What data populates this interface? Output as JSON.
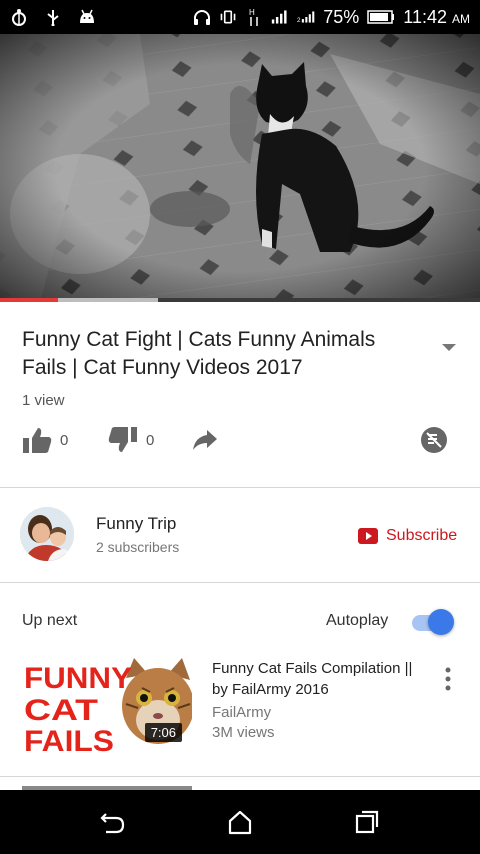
{
  "status_bar": {
    "battery_percent": "75%",
    "time": "11:42",
    "time_suffix": "AM"
  },
  "player": {
    "progress": 0.12,
    "buffered": 0.33
  },
  "video": {
    "title": "Funny Cat Fight | Cats Funny Animals Fails | Cat Funny Videos 2017",
    "views": "1 view",
    "likes": "0",
    "dislikes": "0"
  },
  "channel": {
    "name": "Funny Trip",
    "subscribers": "2 subscribers",
    "subscribe_label": "Subscribe"
  },
  "up_next": {
    "label": "Up next",
    "autoplay_label": "Autoplay",
    "autoplay_on": true,
    "item": {
      "thumb_text": [
        "FUNNY",
        "CAT",
        "FAILS"
      ],
      "duration": "7:06",
      "title": "Funny Cat Fails Compilation || by FailArmy 2016",
      "channel": "FailArmy",
      "views": "3M views"
    }
  },
  "colors": {
    "accent_red": "#cc181e",
    "toggle_blue": "#3b79e8"
  },
  "icons": {
    "status_left": [
      "android-debug-icon",
      "usb-icon",
      "android-icon"
    ],
    "status_right": [
      "headset-icon",
      "vibrate-icon",
      "data-arrows-icon",
      "signal-icon",
      "signal-2-icon",
      "battery-icon"
    ],
    "actions": [
      "thumbs-up-icon",
      "thumbs-down-icon",
      "share-icon",
      "add-to-playlist-icon"
    ],
    "nav": [
      "back-icon",
      "home-icon",
      "recents-icon"
    ]
  }
}
